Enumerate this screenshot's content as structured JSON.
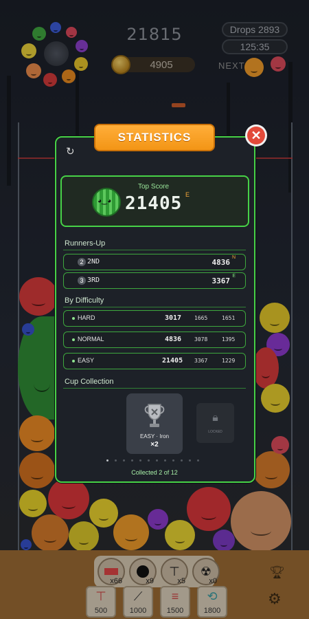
{
  "hud": {
    "score": "21815",
    "drops": "Drops 2893",
    "timer": "125:35",
    "coins": "4905",
    "next_label": "NEXT"
  },
  "tools": [
    {
      "icon": "eraser-icon",
      "count": "x66"
    },
    {
      "icon": "bomb-icon",
      "count": "x9"
    },
    {
      "icon": "hammer-icon",
      "count": "x5"
    },
    {
      "icon": "shake-icon",
      "count": "x0"
    }
  ],
  "shop": [
    {
      "icon": "hammer-icon",
      "price": "500"
    },
    {
      "icon": "sword-icon",
      "price": "1000"
    },
    {
      "icon": "bone-icon",
      "price": "1500"
    },
    {
      "icon": "refresh-icon",
      "price": "1800"
    }
  ],
  "modal": {
    "title": "STATISTICS",
    "top_score_label": "Top Score",
    "top_score": "21405",
    "top_score_badge": "E",
    "runners_up_heading": "Runners-Up",
    "runners_up": [
      {
        "rank": "2",
        "label": "2ND",
        "value": "4836",
        "badge": "N",
        "badge_color": "#f2a63a"
      },
      {
        "rank": "3",
        "label": "3RD",
        "value": "3367",
        "badge": "E",
        "badge_color": "#7fe07f"
      }
    ],
    "difficulty_heading": "By Difficulty",
    "difficulty": [
      {
        "label": "HARD",
        "v1": "3017",
        "v2": "1665",
        "v3": "1651"
      },
      {
        "label": "NORMAL",
        "v1": "4836",
        "v2": "3078",
        "v3": "1395"
      },
      {
        "label": "EASY",
        "v1": "21405",
        "v2": "3367",
        "v3": "1229"
      }
    ],
    "cup_heading": "Cup Collection",
    "cup": {
      "title": "EASY · Iron",
      "count": "×2"
    },
    "locked_label": "LOCKED",
    "collected": "Collected 2 of 12"
  },
  "colors": {
    "accent_green": "#47d247",
    "banner_orange": "#f39516",
    "close_red": "#e24a3a"
  }
}
